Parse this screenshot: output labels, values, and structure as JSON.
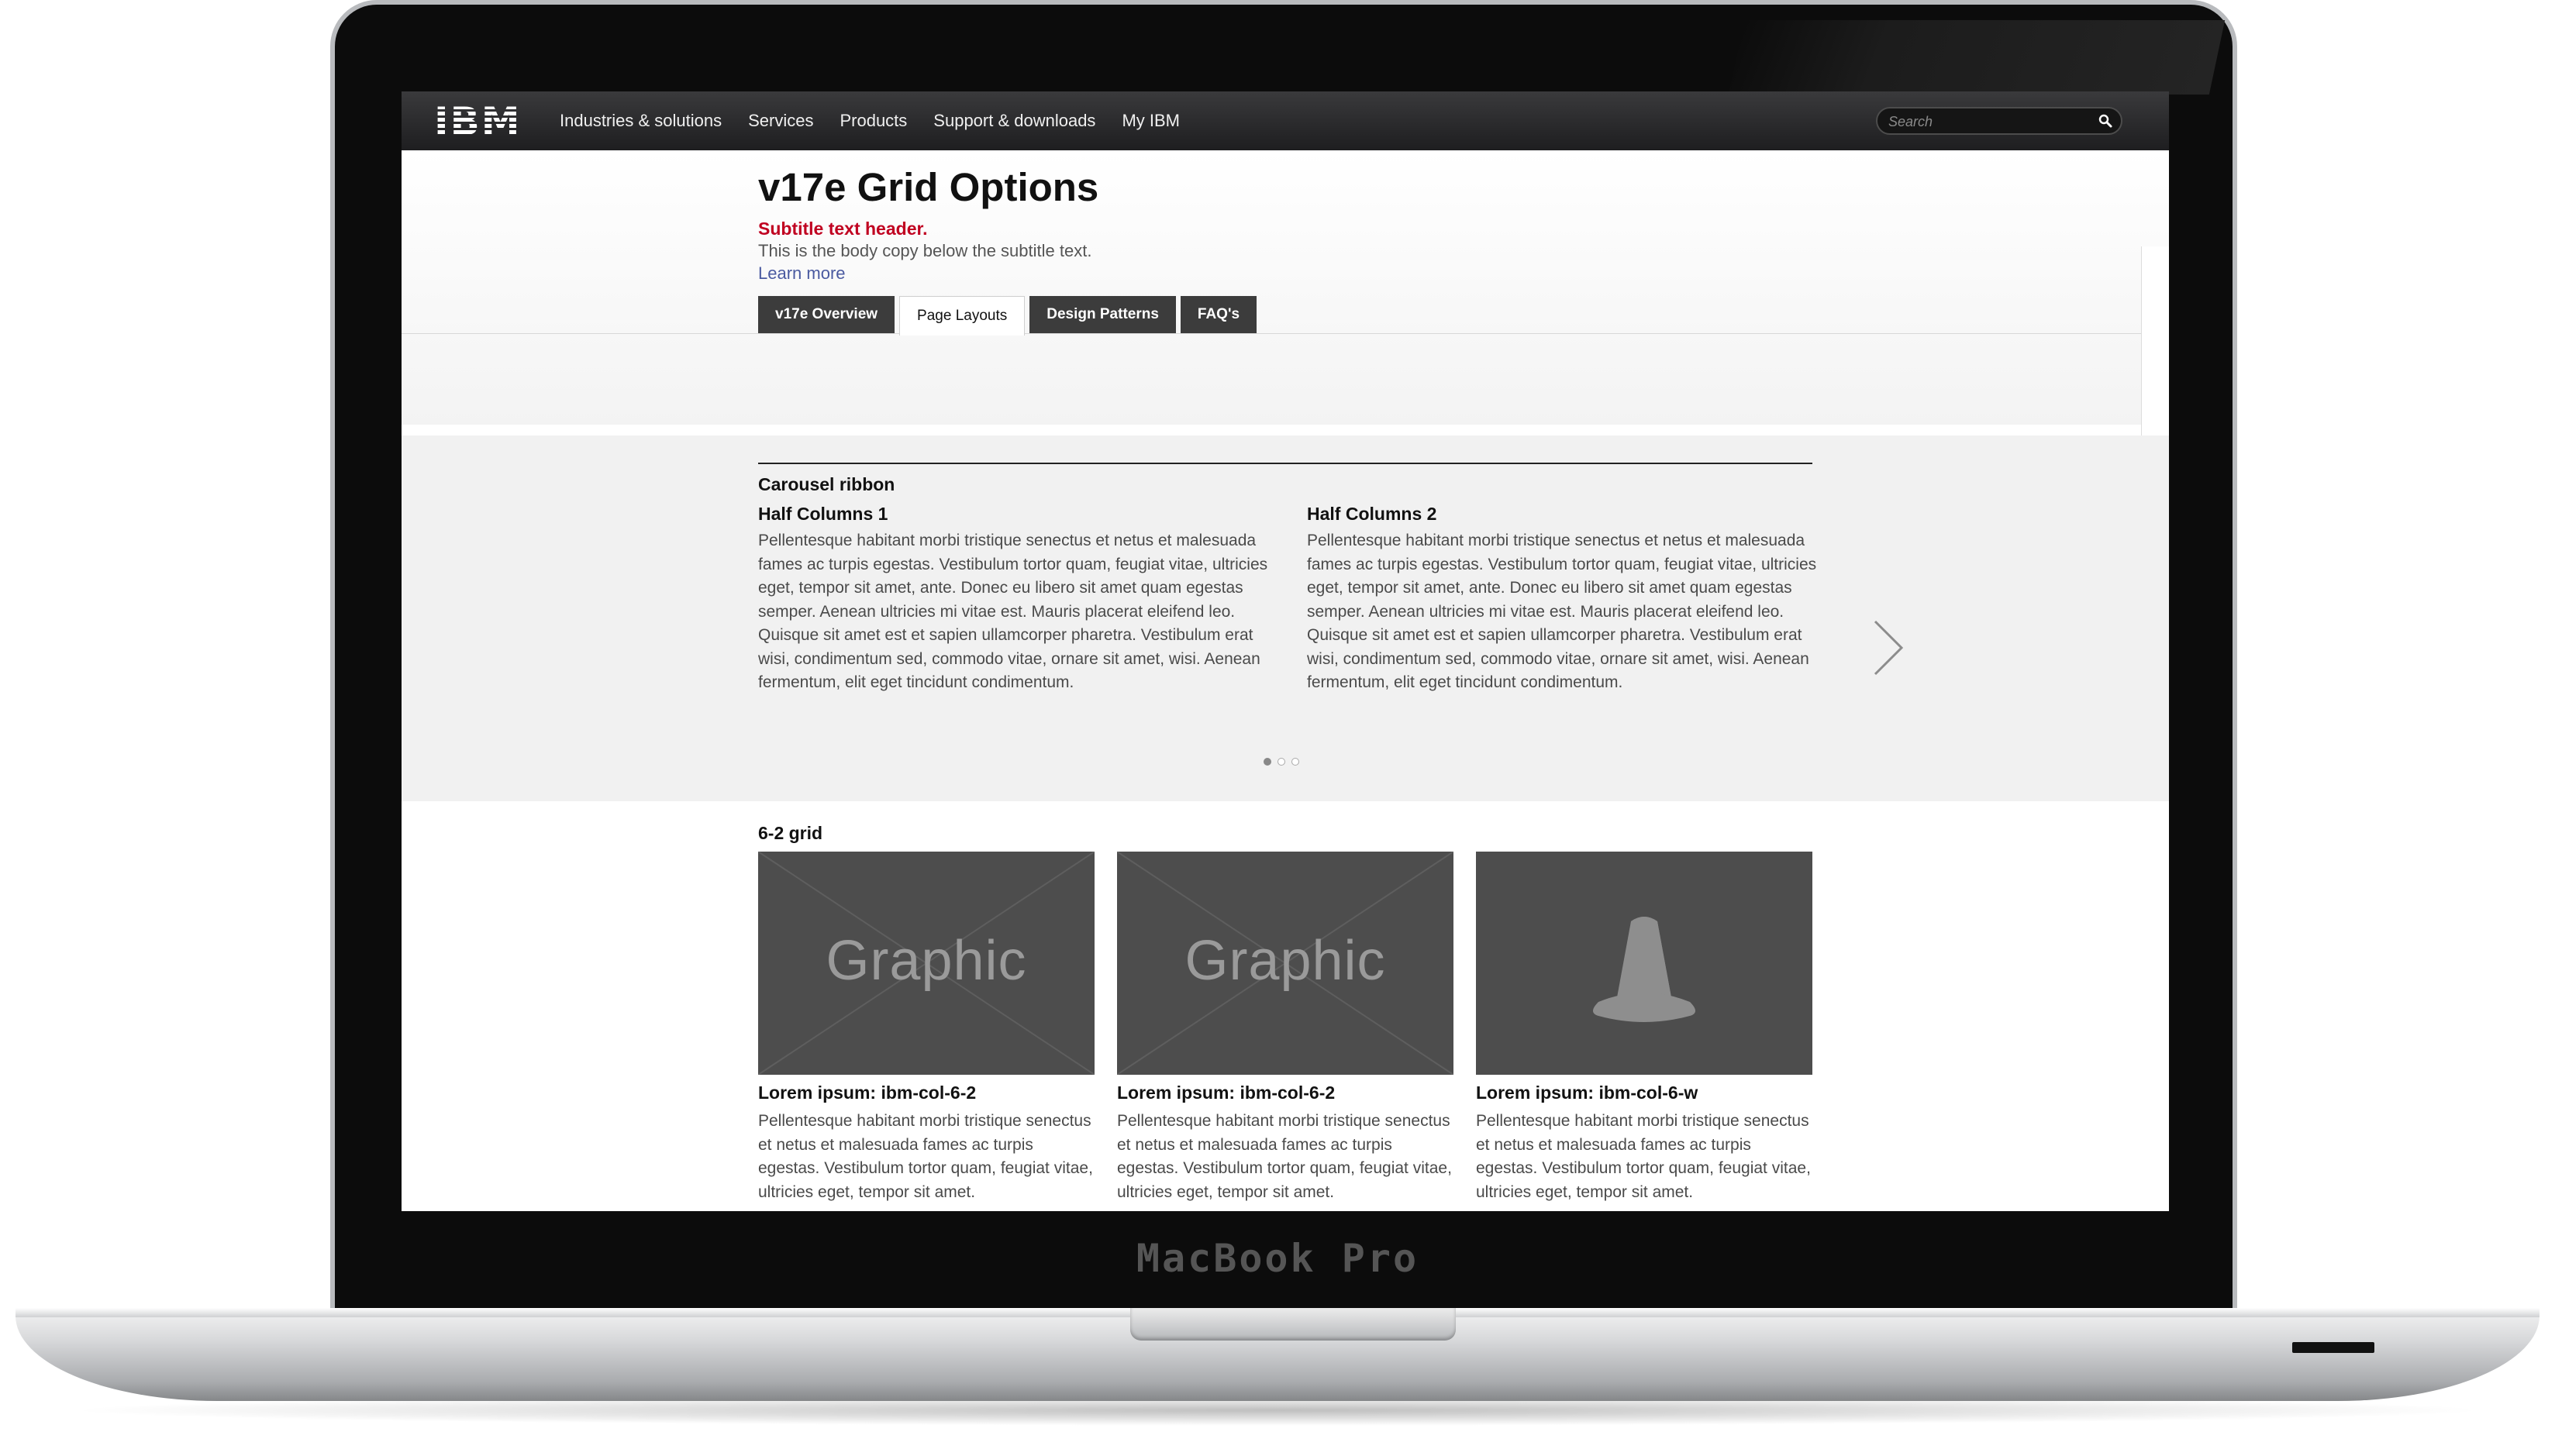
{
  "device": {
    "brand_label": "MacBook Pro"
  },
  "masthead": {
    "logo": "IBM",
    "nav": [
      "Industries & solutions",
      "Services",
      "Products",
      "Support & downloads",
      "My IBM"
    ],
    "search_placeholder": "Search"
  },
  "page": {
    "title": "v17e Grid Options",
    "subtitle": "Subtitle text header.",
    "body": "This is the body copy below the subtitle text.",
    "learn_more": "Learn more",
    "tabs": [
      {
        "label": "v17e Overview",
        "active": false
      },
      {
        "label": "Page Layouts",
        "active": true
      },
      {
        "label": "Design Patterns",
        "active": false
      },
      {
        "label": "FAQ's",
        "active": false
      }
    ]
  },
  "carousel": {
    "label": "Carousel ribbon",
    "columns": [
      {
        "title": "Half Columns 1",
        "text": "Pellentesque habitant morbi tristique senectus et netus et malesuada fames ac turpis egestas. Vestibulum tortor quam, feugiat vitae, ultricies eget, tempor sit amet, ante. Donec eu libero sit amet quam egestas semper. Aenean ultricies mi vitae est. Mauris placerat eleifend leo. Quisque sit amet est et sapien ullamcorper pharetra. Vestibulum erat wisi, condimentum sed, commodo vitae, ornare sit amet, wisi. Aenean fermentum, elit eget tincidunt condimentum."
      },
      {
        "title": "Half Columns 2",
        "text": "Pellentesque habitant morbi tristique senectus et netus et malesuada fames ac turpis egestas. Vestibulum tortor quam, feugiat vitae, ultricies eget, tempor sit amet, ante. Donec eu libero sit amet quam egestas semper. Aenean ultricies mi vitae est. Mauris placerat eleifend leo. Quisque sit amet est et sapien ullamcorper pharetra. Vestibulum erat wisi, condimentum sed, commodo vitae, ornare sit amet, wisi. Aenean fermentum, elit eget tincidunt condimentum."
      }
    ],
    "next_icon": "chevron-right-icon",
    "page_count": 3,
    "active_page": 1
  },
  "grid": {
    "label": "6-2 grid",
    "cards": [
      {
        "graphic": "Graphic",
        "title": "Lorem ipsum: ibm-col-6-2",
        "text": "Pellentesque habitant morbi tristique senectus et netus et malesuada fames ac turpis egestas. Vestibulum tortor quam, feugiat vitae, ultricies eget, tempor sit amet."
      },
      {
        "graphic": "Graphic",
        "title": "Lorem ipsum: ibm-col-6-2",
        "text": "Pellentesque habitant morbi tristique senectus et netus et malesuada fames ac turpis egestas. Vestibulum tortor quam, feugiat vitae, ultricies eget, tempor sit amet."
      },
      {
        "graphic_icon": "traffic-cone-icon",
        "title": "Lorem ipsum: ibm-col-6-w",
        "text": "Pellentesque habitant morbi tristique senectus et netus et malesuada fames ac turpis egestas. Vestibulum tortor quam, feugiat vitae, ultricies eget, tempor sit amet."
      }
    ]
  },
  "colors": {
    "masthead": "#2a2a2c",
    "subtitle": "#c00020",
    "tab": "#3c3c3c",
    "tile": "#4d4d4d",
    "band": "#f1f1f1"
  }
}
